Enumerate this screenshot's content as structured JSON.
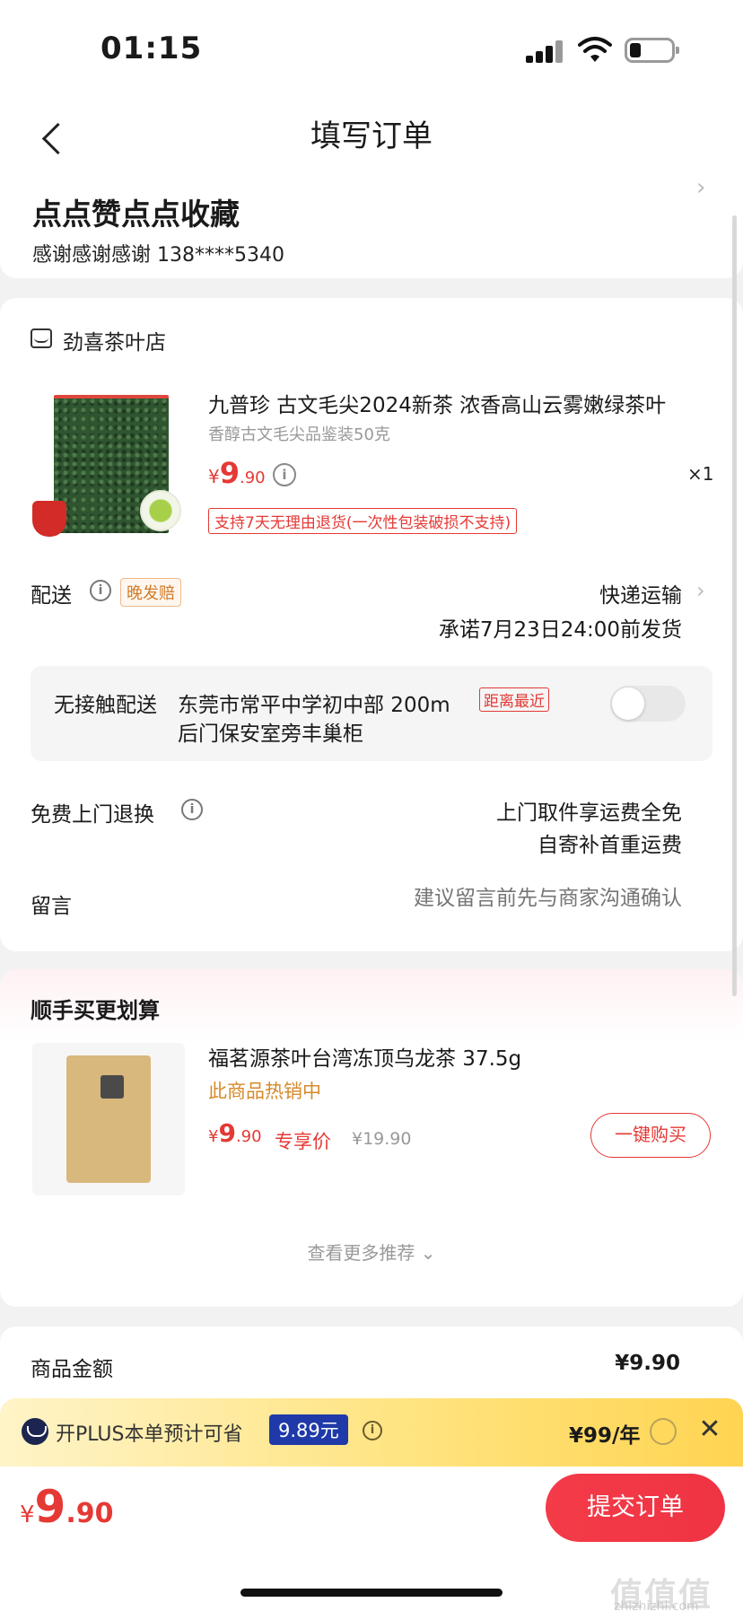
{
  "status_bar": {
    "time": "01:15"
  },
  "header": {
    "title": "填写订单"
  },
  "address": {
    "name": "点点赞点点收藏",
    "contact": "感谢感谢感谢  138****5340"
  },
  "shop": {
    "name": "劲喜茶叶店",
    "product": {
      "title": "九普珍 古文毛尖2024新茶 浓香高山云雾嫩绿茶叶",
      "spec": "香醇古文毛尖品鉴装50克",
      "price_currency": "¥",
      "price_int": "9",
      "price_dec": ".90",
      "info": "i",
      "qty": "×1",
      "return_tag": "支持7天无理由退货(一次性包装破损不支持)"
    }
  },
  "delivery": {
    "label": "配送",
    "info": "i",
    "tag": "晚发赔",
    "method": "快递运输",
    "promise": "承诺7月23日24:00前发货"
  },
  "contactless": {
    "label": "无接触配送",
    "address_line1": "东莞市常平中学初中部 200m",
    "address_line2": "后门保安室旁丰巢柜",
    "tag": "距离最近"
  },
  "free_return": {
    "label": "免费上门退换",
    "info": "i",
    "line1": "上门取件享运费全免",
    "line2": "自寄补首重运费"
  },
  "message": {
    "label": "留言",
    "placeholder": "建议留言前先与商家沟通确认"
  },
  "recommend": {
    "title": "顺手买更划算",
    "item": {
      "name": "福茗源茶叶台湾冻顶乌龙茶 37.5g",
      "hot": "此商品热销中",
      "price_currency": "¥",
      "price_int": "9",
      "price_dec": ".90",
      "price_label": "专享价",
      "original_price": "¥19.90",
      "buy_label": "一键购买"
    },
    "more_label": "查看更多推荐 ⌄"
  },
  "amount": {
    "label": "商品金额",
    "value": "¥9.90"
  },
  "plus": {
    "text": "开PLUS本单预计可省",
    "save": "9.89元",
    "info": "i",
    "price": "¥99/年",
    "close": "✕"
  },
  "bottom": {
    "total_currency": "¥",
    "total_int": "9",
    "total_dec": ".90",
    "submit_label": "提交订单"
  },
  "watermark": {
    "text": "值值值",
    "url": "zhizhizhi.com"
  }
}
